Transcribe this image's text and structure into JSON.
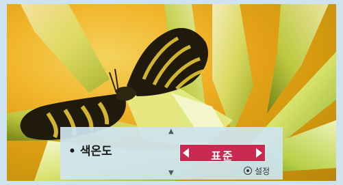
{
  "menu": {
    "item_label": "색온도",
    "bullet": "•",
    "value": "표준",
    "up_arrow": "▲",
    "down_arrow": "▼",
    "hint_label": "설정"
  },
  "icons": {
    "value_left": "triangle-left-icon",
    "value_right": "triangle-right-icon",
    "hint": "ok-button-icon"
  },
  "colors": {
    "value_bg": "#c82a52",
    "osd_bg": "#cde4ef",
    "frame": "#cfe3ee"
  }
}
